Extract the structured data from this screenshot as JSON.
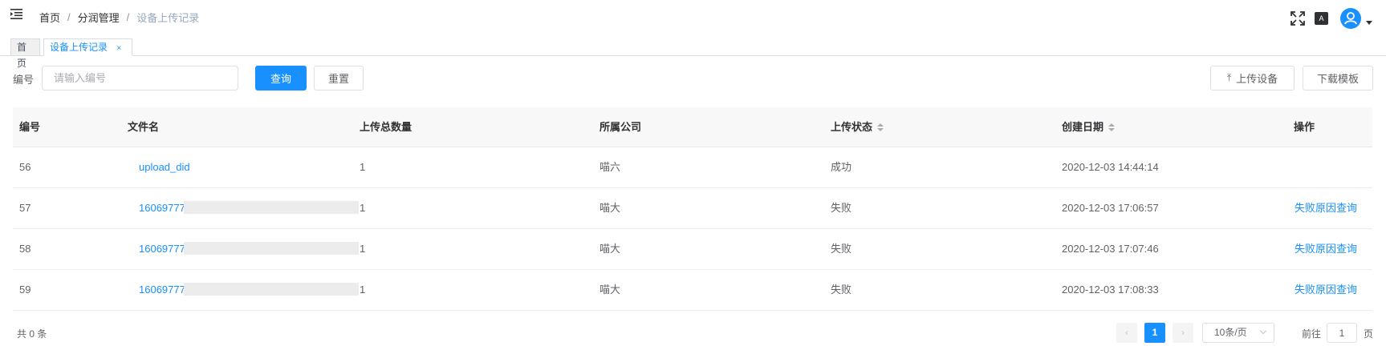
{
  "breadcrumb": {
    "home": "首页",
    "sep1": "/",
    "section": "分润管理",
    "sep2": "/",
    "current": "设备上传记录"
  },
  "header": {
    "size_icon_text": "A",
    "icons": [
      "menu-fold-icon",
      "fullscreen-icon",
      "font-size-icon",
      "user-avatar-icon"
    ]
  },
  "tags": {
    "home": "首页",
    "active": "设备上传记录",
    "close": "×"
  },
  "search": {
    "label": "编号",
    "placeholder": "请输入编号",
    "value": "",
    "query_button": "查询",
    "reset_button": "重置"
  },
  "toolbar": {
    "upload_button": "上传设备",
    "upload_icon": "⤒",
    "template_button": "下载模板"
  },
  "table": {
    "columns": [
      "编号",
      "文件名",
      "上传总数量",
      "所属公司",
      "上传状态",
      "创建日期",
      "操作"
    ],
    "rows": [
      {
        "id": "56",
        "filename": "upload_did",
        "count": "1",
        "company": "喵六",
        "status": "成功",
        "created": "2020-12-03 14:44:14",
        "action": ""
      },
      {
        "id": "57",
        "filename": "16069777",
        "count": "1",
        "company": "喵大",
        "status": "失败",
        "created": "2020-12-03 17:06:57",
        "action": "失败原因查询"
      },
      {
        "id": "58",
        "filename": "16069777",
        "count": "1",
        "company": "喵大",
        "status": "失败",
        "created": "2020-12-03 17:07:46",
        "action": "失败原因查询"
      },
      {
        "id": "59",
        "filename": "16069777",
        "count": "1",
        "company": "喵大",
        "status": "失败",
        "created": "2020-12-03 17:08:33",
        "action": "失败原因查询"
      }
    ]
  },
  "pagination": {
    "total": "共 0 条",
    "prev": "‹",
    "current_page": "1",
    "next": "›",
    "page_size": "10条/页",
    "goto_label": "前往",
    "goto_value": "1",
    "goto_suffix": "页"
  },
  "colors": {
    "primary": "#1890ff",
    "header_bg": "#f8f8f9",
    "text": "#606266"
  }
}
